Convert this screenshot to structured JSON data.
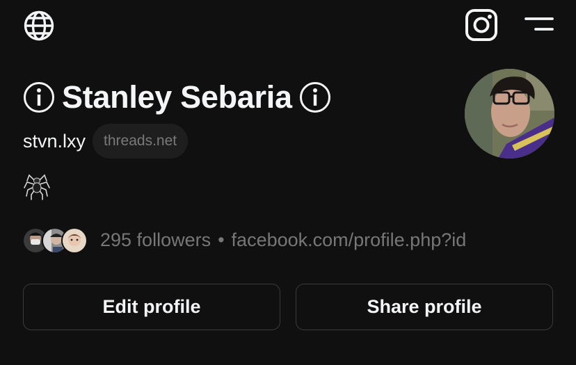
{
  "topbar": {
    "icons": [
      "globe-icon",
      "instagram-icon",
      "menu-icon"
    ]
  },
  "profile": {
    "display_name": "Stanley Sebaria",
    "name_icons": [
      "info-icon",
      "info-icon"
    ],
    "username": "stvn.lxy",
    "domain_badge": "threads.net",
    "bio_icon": "spider-icon",
    "followers_text": "295 followers",
    "separator": "•",
    "link": "facebook.com/profile.php?id"
  },
  "actions": {
    "edit_label": "Edit profile",
    "share_label": "Share profile"
  },
  "colors": {
    "background": "#101010",
    "text": "#f3f5f7",
    "muted": "#777777",
    "border": "#3a3a3a"
  }
}
